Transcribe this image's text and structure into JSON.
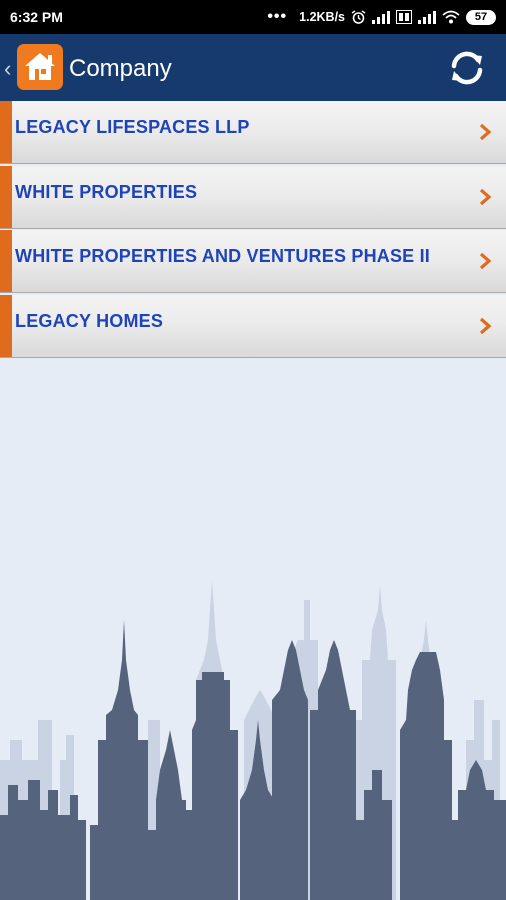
{
  "status_bar": {
    "time": "6:32 PM",
    "more": "•••",
    "speed": "1.2KB/s",
    "battery": "57"
  },
  "app_bar": {
    "title": "Company",
    "icons": [
      "back-icon",
      "home-logo",
      "refresh-icon"
    ]
  },
  "companies": [
    {
      "label": "LEGACY LIFESPACES LLP"
    },
    {
      "label": "WHITE PROPERTIES"
    },
    {
      "label": "WHITE PROPERTIES AND VENTURES PHASE II"
    },
    {
      "label": "LEGACY HOMES"
    }
  ],
  "colors": {
    "app_bar": "#173a6e",
    "accent": "#e06b1d",
    "label_text": "#1f43b8",
    "background": "#e6ecf6",
    "skyline_front": "#55637d",
    "skyline_back": "#c9d3e3"
  }
}
